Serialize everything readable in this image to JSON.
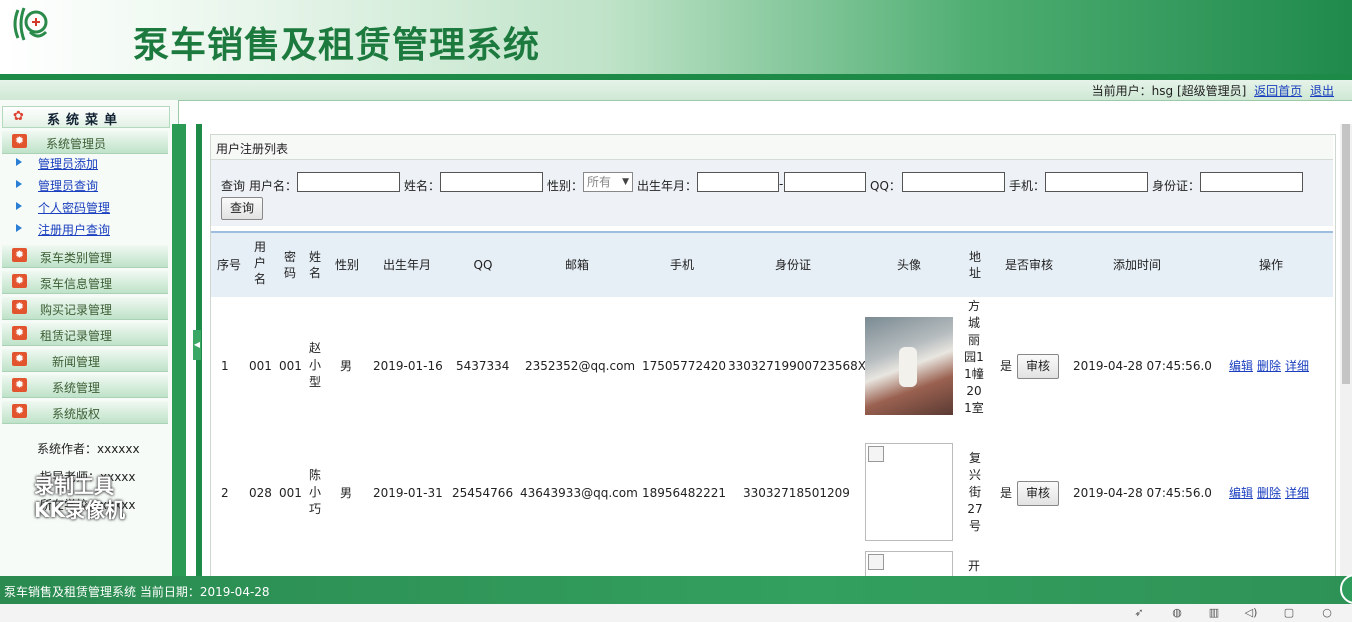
{
  "header": {
    "title": "泵车销售及租赁管理系统"
  },
  "userbar": {
    "current_user": "当前用户：hsg [超级管理员]",
    "home_link": "返回首页",
    "logout_link": "退出"
  },
  "sidebar": {
    "menu_title": "系统菜单",
    "categories": [
      {
        "label": "系统管理员"
      },
      {
        "label": "泵车类别管理"
      },
      {
        "label": "泵车信息管理"
      },
      {
        "label": "购买记录管理"
      },
      {
        "label": "租赁记录管理"
      },
      {
        "label": "新闻管理"
      },
      {
        "label": "系统管理"
      },
      {
        "label": "系统版权"
      }
    ],
    "sub_items": [
      "管理员添加",
      "管理员查询",
      "个人密码管理",
      "注册用户查询"
    ],
    "author": "系统作者：xxxxxx",
    "advisor": "指导老师：xxxxx",
    "school": "所在学校：xxxxx"
  },
  "panel": {
    "title": "用户注册列表"
  },
  "search": {
    "query_label": "查询",
    "username_label": "用户名：",
    "name_label": "姓名：",
    "gender_label": "性别：",
    "gender_value": "所有",
    "birth_label": "出生年月：",
    "dash": "-",
    "qq_label": "QQ：",
    "phone_label": "手机：",
    "idcard_label": "身份证：",
    "button": "查询"
  },
  "table": {
    "headers": [
      "序号",
      "用户名",
      "密码",
      "姓名",
      "性别",
      "出生年月",
      "QQ",
      "邮箱",
      "手机",
      "身份证",
      "头像",
      "地址",
      "是否审核",
      "添加时间",
      "操作"
    ],
    "rows": [
      {
        "no": "1",
        "username": "001",
        "password": "001",
        "name": "赵小型",
        "gender": "男",
        "birth": "2019-01-16",
        "qq": "5437334",
        "email": "2352352@qq.com",
        "phone": "17505772420",
        "idcard": "33032719900723568X",
        "address": "方城丽园11幢201室",
        "approved": "是",
        "approve_btn": "审核",
        "added": "2019-04-28 07:45:56.0",
        "edit": "编辑",
        "delete": "删除",
        "detail": "详细"
      },
      {
        "no": "2",
        "username": "028",
        "password": "001",
        "name": "陈小巧",
        "gender": "男",
        "birth": "2019-01-31",
        "qq": "25454766",
        "email": "43643933@qq.com",
        "phone": "18956482221",
        "idcard": "33032718501209",
        "address": "复兴街27号",
        "approved": "是",
        "approve_btn": "审核",
        "added": "2019-04-28 07:45:56.0",
        "edit": "编辑",
        "delete": "删除",
        "detail": "详细"
      },
      {
        "address_partial": "开"
      }
    ]
  },
  "footer": {
    "text": "泵车销售及租赁管理系统 当前日期：2019-04-28"
  },
  "watermark": {
    "line1": "录制工具",
    "line2": "KK录像机"
  },
  "taskbar": {
    "icons": [
      "rocket-icon",
      "browser-icon",
      "trash-icon",
      "volume-icon",
      "window-icon",
      "search-icon"
    ]
  }
}
